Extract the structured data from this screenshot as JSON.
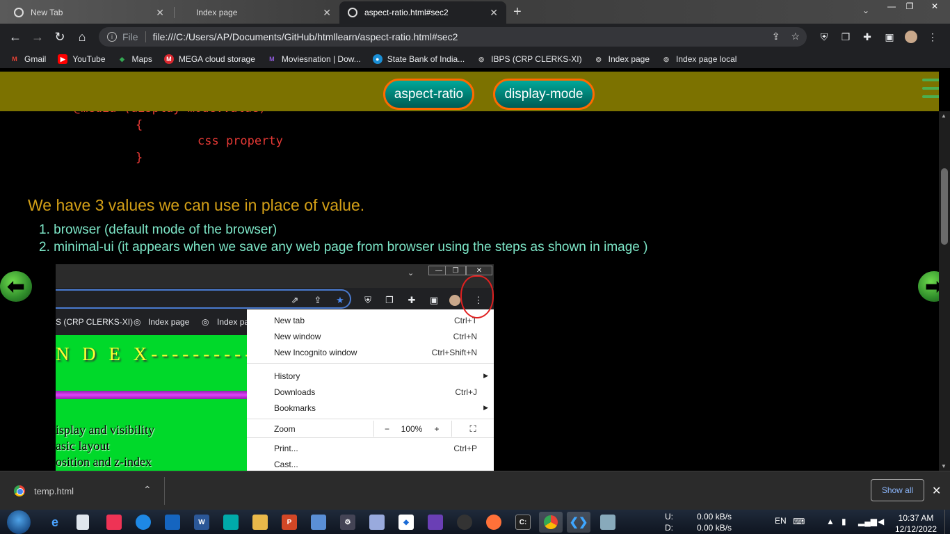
{
  "tabs": [
    {
      "label": "New Tab"
    },
    {
      "label": "Index page"
    },
    {
      "label": "aspect-ratio.html#sec2"
    }
  ],
  "address": {
    "scheme": "File",
    "url": "file:///C:/Users/AP/Documents/GitHub/htmllearn/aspect-ratio.html#sec2"
  },
  "bookmarks": [
    {
      "label": "Gmail",
      "color": "#ea4335",
      "glyph": "M"
    },
    {
      "label": "YouTube",
      "color": "#ff0000",
      "glyph": "▶"
    },
    {
      "label": "Maps",
      "color": "#34a853",
      "glyph": "◆"
    },
    {
      "label": "MEGA cloud storage",
      "color": "#d9272e",
      "glyph": "M"
    },
    {
      "label": "Moviesnation | Dow...",
      "color": "#6a3fb5",
      "glyph": "M"
    },
    {
      "label": "State Bank of India...",
      "color": "#1a8fd6",
      "glyph": "●"
    },
    {
      "label": "IBPS (CRP CLERKS-XI)",
      "color": "#555555",
      "glyph": "◎"
    },
    {
      "label": "Index page",
      "color": "#555555",
      "glyph": "◎"
    },
    {
      "label": "Index page local",
      "color": "#555555",
      "glyph": "◎"
    }
  ],
  "page": {
    "nav_buttons": [
      {
        "label": "aspect-ratio"
      },
      {
        "label": "display-mode"
      }
    ],
    "code": {
      "line1": "@media (display-mode:value)",
      "line2": "{",
      "line3": "css property",
      "line4": "}"
    },
    "heading": "We have 3 values we can use in place of value.",
    "list": [
      {
        "label": "1. browser (default mode of the browser)"
      },
      {
        "label": "2. minimal-ui (it appears when we save any web page from browser using the steps as shown in image )"
      }
    ]
  },
  "embedded": {
    "bookmarks": [
      {
        "label": "S (CRP CLERKS-XI)"
      },
      {
        "label": "Index page"
      },
      {
        "label": "Index pa"
      }
    ],
    "index_title": "N D E X---------------",
    "green_list": [
      {
        "label": "isplay and visibility"
      },
      {
        "label": "asic layout"
      },
      {
        "label": "osition and z-index"
      }
    ],
    "menu": {
      "items": [
        {
          "label": "New tab",
          "shortcut": "Ctrl+T"
        },
        {
          "label": "New window",
          "shortcut": "Ctrl+N"
        },
        {
          "label": "New Incognito window",
          "shortcut": "Ctrl+Shift+N"
        },
        {
          "label": "History",
          "shortcut": ""
        },
        {
          "label": "Downloads",
          "shortcut": "Ctrl+J"
        },
        {
          "label": "Bookmarks",
          "shortcut": ""
        },
        {
          "label": "Print...",
          "shortcut": "Ctrl+P"
        },
        {
          "label": "Cast...",
          "shortcut": ""
        }
      ],
      "zoom": {
        "label": "Zoom",
        "minus": "−",
        "value": "100%",
        "plus": "+"
      }
    }
  },
  "download": {
    "file": "temp.html",
    "show_all": "Show all"
  },
  "taskbar": {
    "net_up_label": "U:",
    "net_up": "0.00 kB/s",
    "net_down_label": "D:",
    "net_down": "0.00 kB/s",
    "lang": "EN",
    "time": "10:37 AM",
    "date": "12/12/2022"
  },
  "colors": {
    "page_bar": "#7c7200",
    "pill_border": "#ff6a00",
    "code": "#e53935",
    "heading": "#d4a017",
    "list": "#7ee8c9"
  }
}
